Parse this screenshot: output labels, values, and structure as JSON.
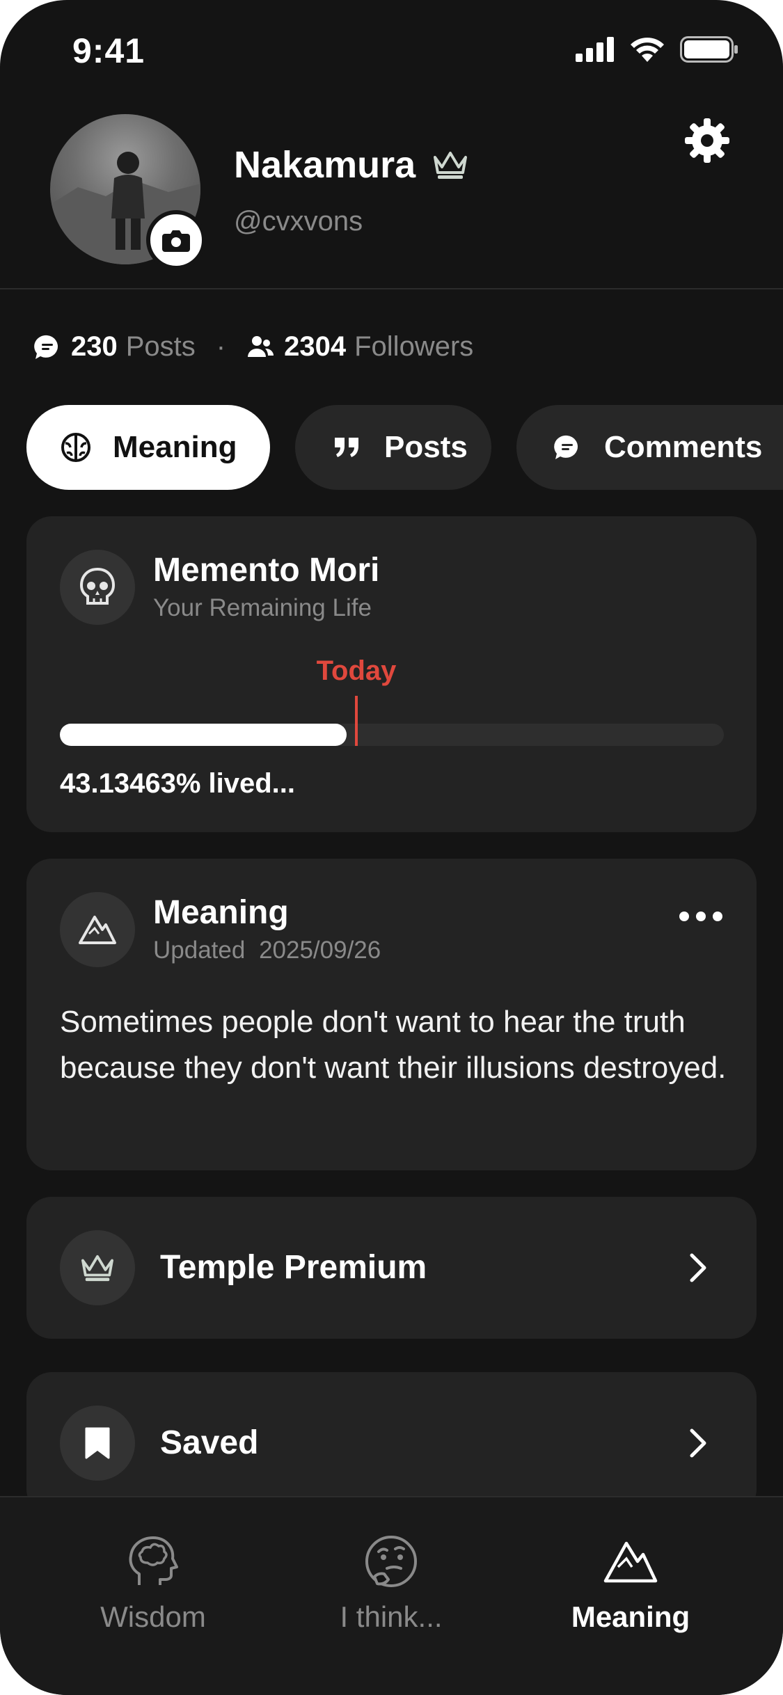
{
  "status_bar": {
    "time": "9:41",
    "icons": [
      "signal-icon",
      "wifi-icon",
      "battery-icon"
    ]
  },
  "profile": {
    "name": "Nakamura",
    "handle": "@cvxvons",
    "badge_icon": "crown-icon",
    "avatar_badge_icon": "camera-icon",
    "settings_icon": "gear-icon"
  },
  "stats": {
    "posts_count": "230",
    "posts_label": "Posts",
    "separator": "·",
    "followers_count": "2304",
    "followers_label": "Followers"
  },
  "tabs": [
    {
      "label": "Meaning",
      "icon": "brain-icon",
      "active": true
    },
    {
      "label": "Posts",
      "icon": "quote-icon",
      "active": false
    },
    {
      "label": "Comments",
      "icon": "chat-icon",
      "active": false
    }
  ],
  "memento": {
    "icon": "skull-icon",
    "title": "Memento Mori",
    "subtitle": "Your Remaining Life",
    "today_label": "Today",
    "progress_percent": 43.13463,
    "lived_text": "43.13463% lived..."
  },
  "meaning_card": {
    "icon": "mountain-icon",
    "title": "Meaning",
    "updated_label": "Updated",
    "updated_date": "2025/09/26",
    "quote": "Sometimes people don't want to hear the truth because they don't want their illusions destroyed.",
    "menu_icon": "more-dots-icon"
  },
  "rows": [
    {
      "label": "Temple Premium",
      "icon": "crown-icon"
    },
    {
      "label": "Saved",
      "icon": "bookmark-icon"
    }
  ],
  "bottom_nav": [
    {
      "label": "Wisdom",
      "icon": "head-brain-icon",
      "active": false
    },
    {
      "label": "I think...",
      "icon": "thinking-face-icon",
      "active": false
    },
    {
      "label": "Meaning",
      "icon": "mountain-icon",
      "active": true
    }
  ],
  "colors": {
    "background": "#141414",
    "card": "#232323",
    "accent_today": "#e0483d",
    "muted_text": "#8a8a8a"
  }
}
